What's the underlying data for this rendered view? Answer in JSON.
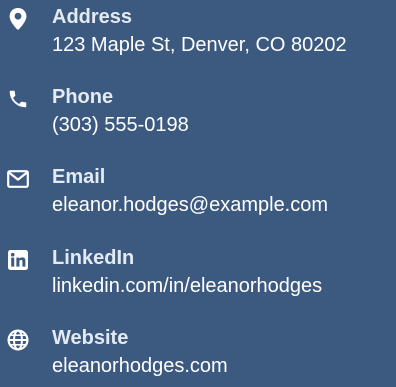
{
  "contact": {
    "items": [
      {
        "icon": "map-marker-icon",
        "label": "Address",
        "value": "123 Maple St, Denver, CO 80202"
      },
      {
        "icon": "phone-icon",
        "label": "Phone",
        "value": "(303) 555-0198"
      },
      {
        "icon": "envelope-icon",
        "label": "Email",
        "value": "eleanor.hodges@example.com"
      },
      {
        "icon": "linkedin-icon",
        "label": "LinkedIn",
        "value": "linkedin.com/in/eleanorhodges"
      },
      {
        "icon": "globe-icon",
        "label": "Website",
        "value": "eleanorhodges.com"
      }
    ]
  },
  "colors": {
    "background": "#3c5a80",
    "text": "#ffffff",
    "label": "#e4eaf2"
  }
}
